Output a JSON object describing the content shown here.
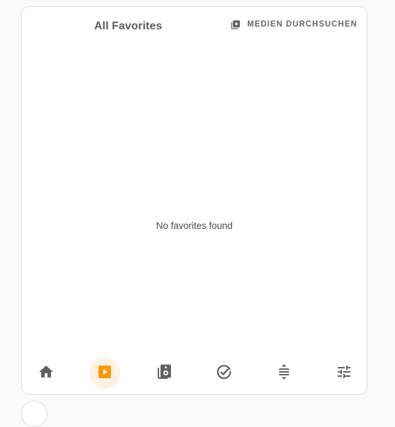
{
  "header": {
    "title": "All Favorites",
    "browse_label": "MEDIEN DURCHSUCHEN"
  },
  "main": {
    "empty_message": "No favorites found"
  },
  "nav": {
    "items": [
      {
        "name": "home",
        "icon": "home-icon",
        "active": false
      },
      {
        "name": "media",
        "icon": "play-box-icon",
        "active": true
      },
      {
        "name": "speaker",
        "icon": "speaker-icon",
        "active": false
      },
      {
        "name": "check",
        "icon": "check-circle-icon",
        "active": false
      },
      {
        "name": "group",
        "icon": "expand-vertical-icon",
        "active": false
      },
      {
        "name": "settings",
        "icon": "tune-icon",
        "active": false
      }
    ]
  },
  "colors": {
    "accent": "#ff9800",
    "icon": "#616161",
    "active_bg": "#fdf1e1"
  }
}
